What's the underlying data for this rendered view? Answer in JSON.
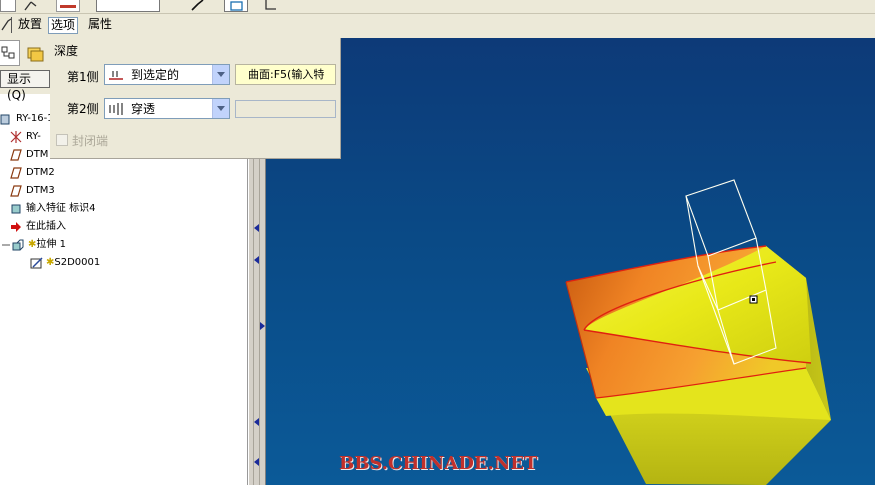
{
  "tabs": {
    "placement": "放置",
    "options": "选项",
    "properties": "属性"
  },
  "options_panel": {
    "depth_label": "深度",
    "side1": {
      "label": "第1侧",
      "value": "到选定的",
      "reference": "曲面:F5(输入特"
    },
    "side2": {
      "label": "第2侧",
      "value": "穿透",
      "reference": ""
    },
    "capped_ends": {
      "label": "封闭端",
      "checked": false,
      "enabled": false
    }
  },
  "model_tree": {
    "show_button": "显示(Q)",
    "items": [
      {
        "label": "RY-16-1",
        "icon": "part-icon"
      },
      {
        "label": "RY-",
        "icon": "csys-icon"
      },
      {
        "label": "DTM",
        "icon": "datum-plane-icon"
      },
      {
        "label": "DTM2",
        "icon": "datum-plane-icon"
      },
      {
        "label": "DTM3",
        "icon": "datum-plane-icon"
      },
      {
        "label": "输入特征 标识4",
        "icon": "import-feature-icon"
      },
      {
        "label": "在此插入",
        "icon": "insert-here-arrow-icon"
      },
      {
        "label": "拉伸 1",
        "icon": "extrude-icon"
      },
      {
        "label": "S2D0001",
        "icon": "sketch-icon"
      }
    ]
  },
  "watermark": "BBS.CHINADE.NET",
  "colors": {
    "viewport_top": "#0d3a78",
    "viewport_bottom": "#0b5a98",
    "surface_yellow": "#e8e818",
    "surface_orange": "#f07818",
    "edge_red": "#e02010",
    "watermark_red": "#c0312c"
  }
}
